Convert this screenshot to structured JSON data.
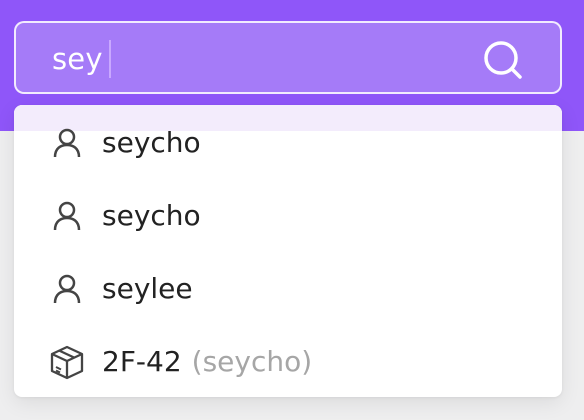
{
  "search": {
    "value": "sey",
    "icon": "search-icon"
  },
  "results": [
    {
      "type": "user",
      "icon": "user-icon",
      "label": "seycho"
    },
    {
      "type": "user",
      "icon": "user-icon",
      "label": "seycho"
    },
    {
      "type": "user",
      "icon": "user-icon",
      "label": "seylee"
    },
    {
      "type": "item",
      "icon": "box-icon",
      "label": "2F-42",
      "owner": "(seycho)"
    }
  ],
  "colors": {
    "accent": "#8f56f9",
    "search_fill": "#a57bf8",
    "highlight": "#f3ecfc",
    "muted_text": "#a6a6a6"
  }
}
